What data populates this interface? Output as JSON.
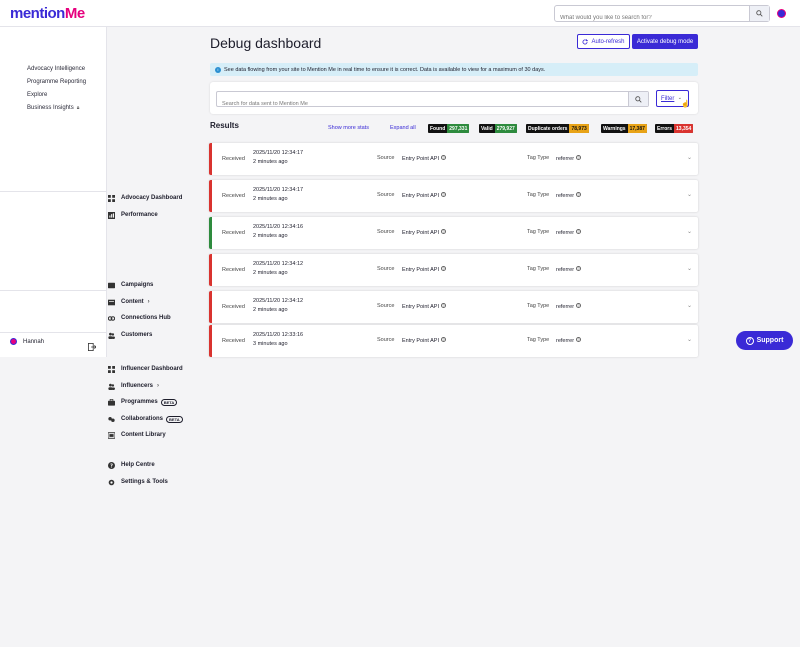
{
  "header": {
    "logo_text_1": "mention",
    "logo_text_2": "Me",
    "search_placeholder": "What would you like to search for?"
  },
  "sidebar": {
    "items": {
      "advocacy": "Advocacy Dashboard",
      "performance": "Performance",
      "advocacy_intelligence": "Advocacy Intelligence",
      "programme_reporting": "Programme Reporting",
      "explore": "Explore",
      "business_insights": "Business Insights",
      "campaigns": "Campaigns",
      "content": "Content",
      "connections_hub": "Connections Hub",
      "customers": "Customers",
      "influencer_dashboard": "Influencer Dashboard",
      "influencers": "Influencers",
      "programmes": "Programmes",
      "collaborations": "Collaborations",
      "content_library": "Content Library",
      "help_centre": "Help Centre",
      "settings": "Settings & Tools"
    },
    "beta_label": "BETA",
    "user_name": "Hannah"
  },
  "page": {
    "title": "Debug dashboard",
    "auto_refresh": "Auto-refresh",
    "activate_debug": "Activate debug mode",
    "info_text": "See data flowing from your site to Mention Me in real time to ensure it is correct. Data is available to view for a maximum of 30 days.",
    "data_search_placeholder": "Search for data sent to Mention Me",
    "filter_label": "Filter"
  },
  "results": {
    "title": "Results",
    "show_more_stats": "Show more stats",
    "expand_all": "Expand all",
    "stats": [
      {
        "label": "Found",
        "value": "297,331",
        "color": "#2e8b3e"
      },
      {
        "label": "Valid",
        "value": "279,927",
        "color": "#2e8b3e"
      },
      {
        "label": "Duplicate orders",
        "value": "78,973",
        "color": "#e8a317"
      },
      {
        "label": "Warnings",
        "value": "17,387",
        "color": "#e8a317"
      },
      {
        "label": "Errors",
        "value": "13,354",
        "color": "#d9332f"
      }
    ],
    "field_labels": {
      "received": "Received",
      "source": "Source",
      "tag_type": "Tag Type"
    },
    "rows": [
      {
        "status": "error",
        "timestamp": "2025/11/20 12:34:17",
        "ago": "2 minutes ago",
        "source": "Entry Point API",
        "tag_type": "referrer"
      },
      {
        "status": "error",
        "timestamp": "2025/11/20 12:34:17",
        "ago": "2 minutes ago",
        "source": "Entry Point API",
        "tag_type": "referrer"
      },
      {
        "status": "ok",
        "timestamp": "2025/11/20 12:34:16",
        "ago": "2 minutes ago",
        "source": "Entry Point API",
        "tag_type": "referrer"
      },
      {
        "status": "error",
        "timestamp": "2025/11/20 12:34:12",
        "ago": "2 minutes ago",
        "source": "Entry Point API",
        "tag_type": "referrer"
      },
      {
        "status": "error",
        "timestamp": "2025/11/20 12:34:12",
        "ago": "2 minutes ago",
        "source": "Entry Point API",
        "tag_type": "referrer"
      },
      {
        "status": "error",
        "timestamp": "2025/11/20 12:33:16",
        "ago": "3 minutes ago",
        "source": "Entry Point API",
        "tag_type": "referrer"
      }
    ]
  },
  "support": {
    "label": "Support"
  }
}
